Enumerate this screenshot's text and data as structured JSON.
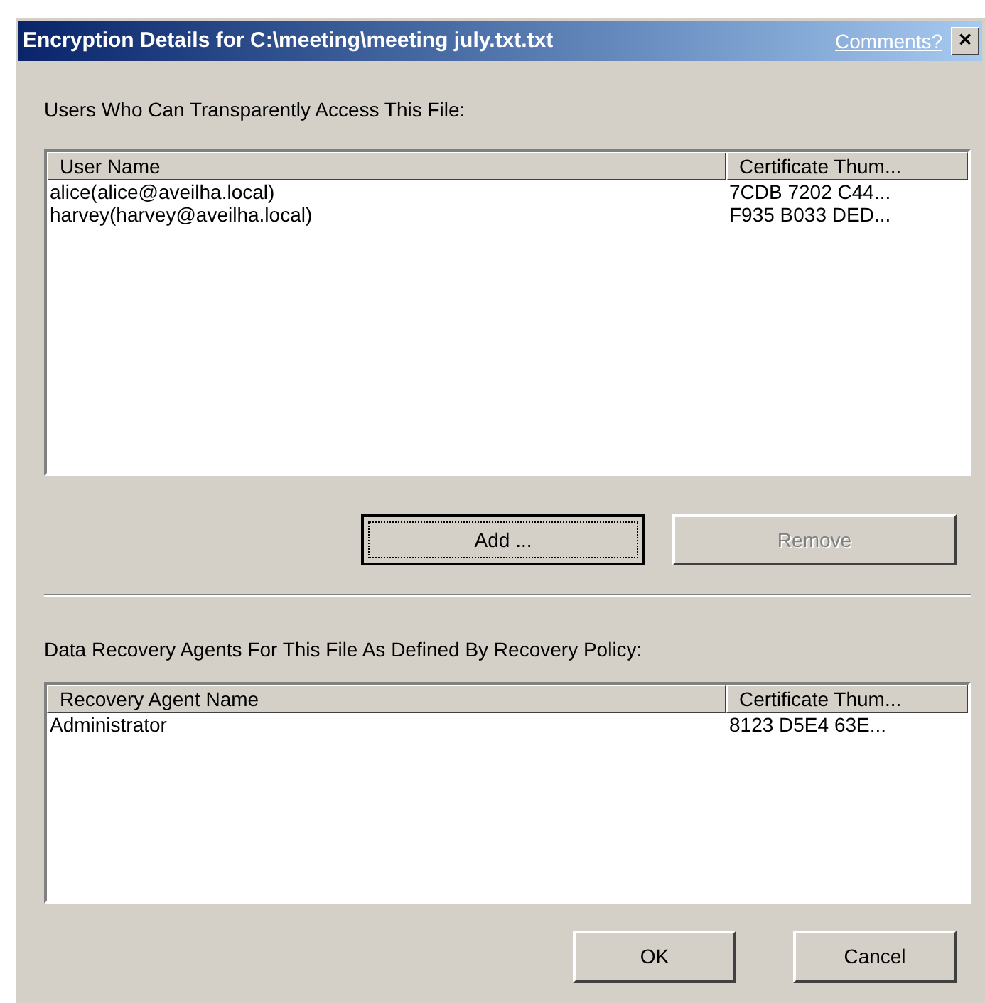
{
  "window": {
    "title": "Encryption Details for C:\\meeting\\meeting july.txt.txt",
    "help_link": "Comments?",
    "close": "×"
  },
  "users_label": "Users Who Can Transparently Access This File:",
  "users_table": {
    "columns": [
      "User Name",
      "Certificate Thum..."
    ],
    "rows": [
      [
        "alice(alice@aveilha.local)",
        "7CDB 7202 C44..."
      ],
      [
        "harvey(harvey@aveilha.local)",
        "F935 B033 DED..."
      ]
    ]
  },
  "user_buttons": [
    {
      "label": "Add ...",
      "disabled": false,
      "default": true
    },
    {
      "label": "Remove",
      "disabled": true,
      "default": false
    }
  ],
  "agents_label": "Data Recovery Agents For This File As Defined By Recovery Policy:",
  "agents_table": {
    "columns": [
      "Recovery Agent Name",
      "Certificate Thum..."
    ],
    "rows": [
      [
        "Administrator",
        "8123 D5E4 63E..."
      ]
    ]
  },
  "buttons": [
    {
      "label": "OK",
      "disabled": false,
      "default": false
    },
    {
      "label": "Cancel",
      "disabled": false,
      "default": false
    }
  ]
}
